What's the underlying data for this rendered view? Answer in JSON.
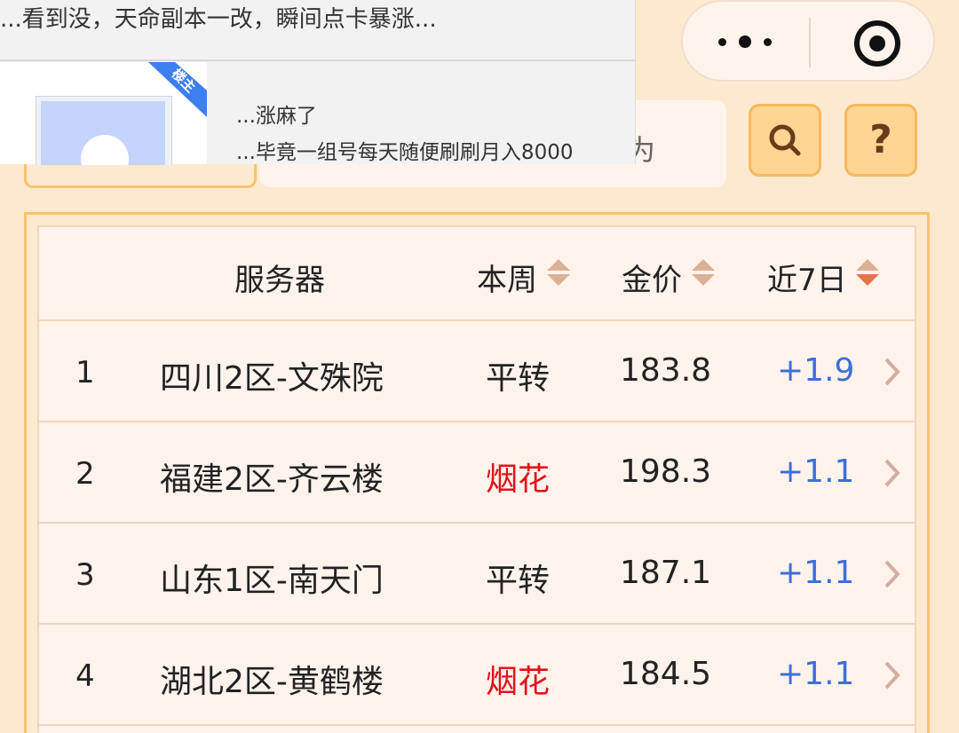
{
  "capsule": {
    "more_icon": "more-dots-icon",
    "target_icon": "target-icon"
  },
  "search": {
    "visible_text": "为",
    "search_icon": "search-icon",
    "help_icon": "question-icon",
    "help_label": "?"
  },
  "notification": {
    "headline": "...看到没，天命副本一改，瞬间点卡暴涨...",
    "corner_badge": "楼主",
    "line1": "...涨麻了",
    "line2": "...毕竟一组号每天随便刷刷月入8000"
  },
  "table": {
    "headers": {
      "server": "服务器",
      "week": "本周",
      "price": "金价",
      "last7": "近7日"
    },
    "rows": [
      {
        "rank": "1",
        "server": "四川2区-文殊院",
        "week": "平转",
        "week_color": "#222222",
        "price": "183.8",
        "change": "+1.9"
      },
      {
        "rank": "2",
        "server": "福建2区-齐云楼",
        "week": "烟花",
        "week_color": "#e0121b",
        "price": "198.3",
        "change": "+1.1"
      },
      {
        "rank": "3",
        "server": "山东1区-南天门",
        "week": "平转",
        "week_color": "#222222",
        "price": "187.1",
        "change": "+1.1"
      },
      {
        "rank": "4",
        "server": "湖北2区-黄鹤楼",
        "week": "烟花",
        "week_color": "#e0121b",
        "price": "184.5",
        "change": "+1.1"
      }
    ]
  },
  "colors": {
    "accent": "#f6c46b",
    "positive": "#3e6fd8",
    "event": "#e0121b",
    "background": "#fde9cf"
  }
}
